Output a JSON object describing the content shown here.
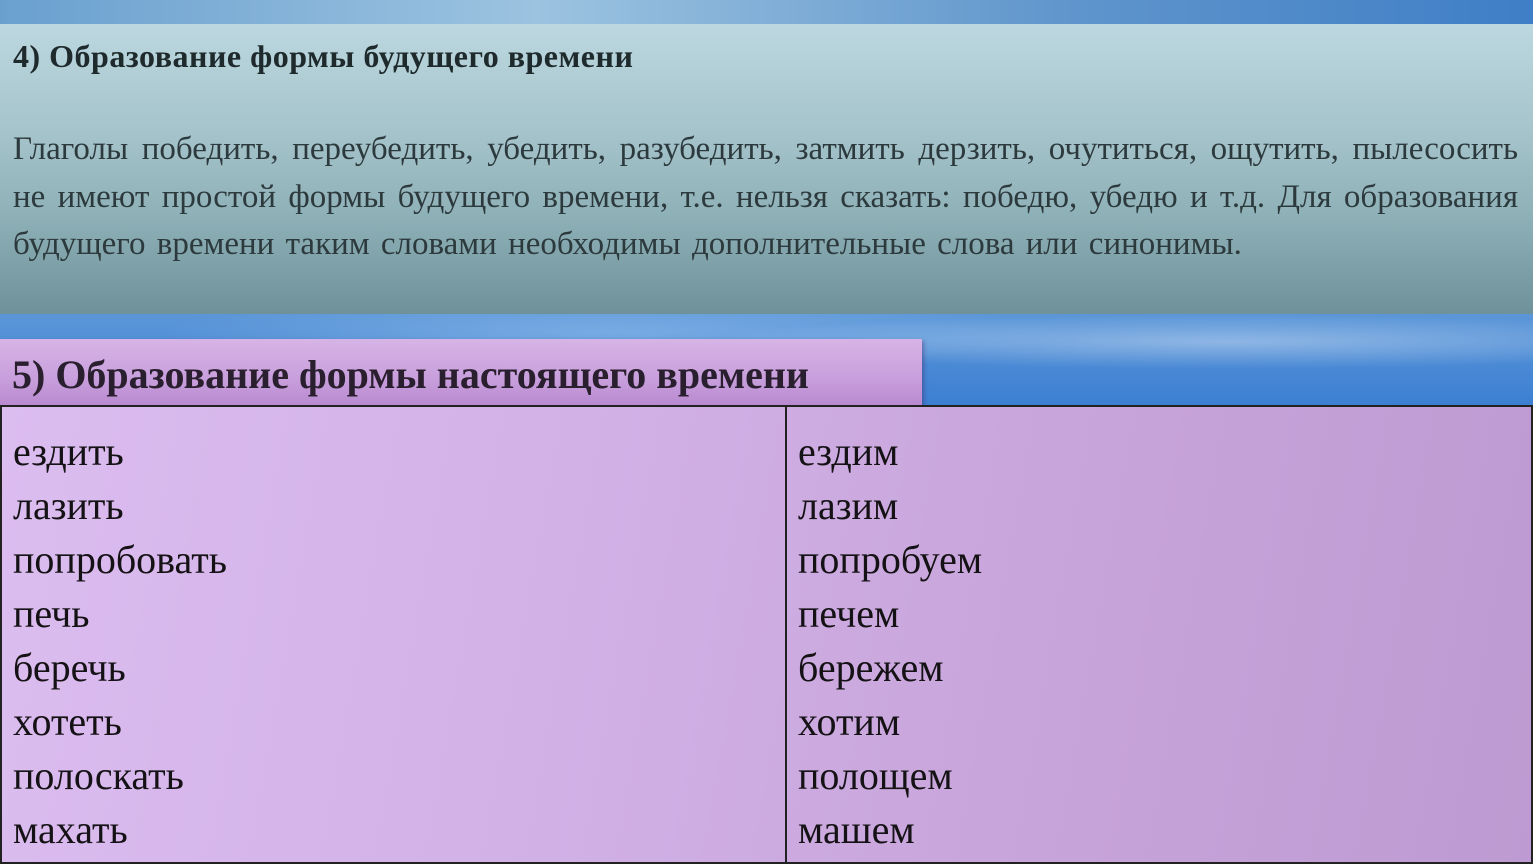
{
  "section4": {
    "title": "4) Образование формы будущего времени",
    "body": "Глаголы победить, переубедить, убедить, разубедить, затмить дерзить, очутиться, ощутить, пылесосить не имеют простой формы будущего времени, т.е. нельзя сказать: победю, убедю и т.д. Для образования будущего времени таким словами необходимы дополнительные слова или синонимы."
  },
  "section5": {
    "title": "5) Образование формы настоящего времени",
    "left_column": [
      "ездить",
      "лазить",
      "попробовать",
      "печь",
      "беречь",
      "хотеть",
      "полоскать",
      "махать"
    ],
    "right_column": [
      "ездим",
      "лазим",
      "попробуем",
      "печем",
      "бережем",
      "хотим",
      "полощем",
      "машем"
    ]
  }
}
